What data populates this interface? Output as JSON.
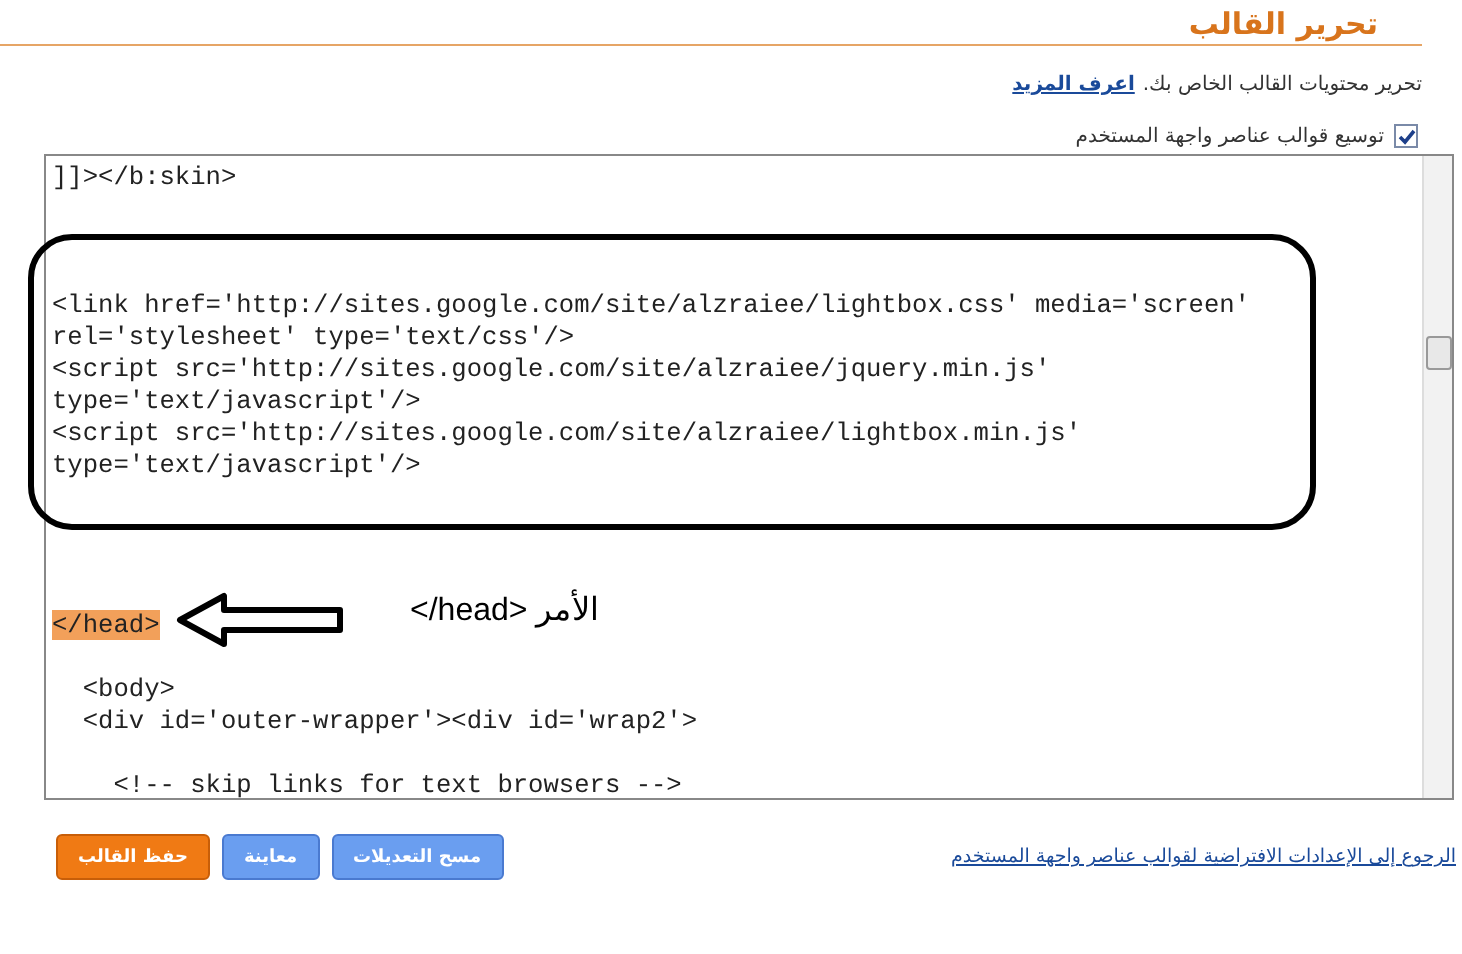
{
  "page_title": "تحرير القالب",
  "description": {
    "text": "تحرير محتويات القالب الخاص بك.",
    "link": "اعرف المزيد"
  },
  "expand_widgets": {
    "label": "توسيع قوالب عناصر واجهة المستخدم",
    "checked": true
  },
  "editor": {
    "lines": [
      {
        "kind": "code",
        "text": "]]></b:skin>",
        "highlighted": false
      },
      {
        "kind": "blank"
      },
      {
        "kind": "blank"
      },
      {
        "kind": "blank"
      },
      {
        "kind": "code",
        "text": "<link href='http://sites.google.com/site/alzraiee/lightbox.css' media='screen'",
        "highlighted": false
      },
      {
        "kind": "code",
        "text": "rel='stylesheet' type='text/css'/>",
        "highlighted": false
      },
      {
        "kind": "code",
        "text": "<script src='http://sites.google.com/site/alzraiee/jquery.min.js'",
        "highlighted": false
      },
      {
        "kind": "code",
        "text": "type='text/javascript'/>",
        "highlighted": false
      },
      {
        "kind": "code",
        "text": "<script src='http://sites.google.com/site/alzraiee/lightbox.min.js'",
        "highlighted": false
      },
      {
        "kind": "code",
        "text": "type='text/javascript'/>",
        "highlighted": false
      },
      {
        "kind": "blank"
      },
      {
        "kind": "blank"
      },
      {
        "kind": "blank"
      },
      {
        "kind": "blank"
      },
      {
        "kind": "code",
        "text": "</head>",
        "highlighted": true
      },
      {
        "kind": "blank"
      },
      {
        "kind": "code",
        "text": "  <body>",
        "highlighted": false
      },
      {
        "kind": "code",
        "text": "  <div id='outer-wrapper'><div id='wrap2'>",
        "highlighted": false
      },
      {
        "kind": "blank"
      },
      {
        "kind": "code",
        "text": "    <!-- skip links for text browsers -->",
        "highlighted": false
      }
    ],
    "annotation": "</head> الأمر"
  },
  "reset_link": "الرجوع إلى الإعدادات الافتراضية لقوالب عناصر واجهة المستخدم",
  "buttons": [
    {
      "label": "مسح التعديلات",
      "kind": "secondary"
    },
    {
      "label": "معاينة",
      "kind": "secondary"
    },
    {
      "label": "حفظ القالب",
      "kind": "primary"
    }
  ]
}
